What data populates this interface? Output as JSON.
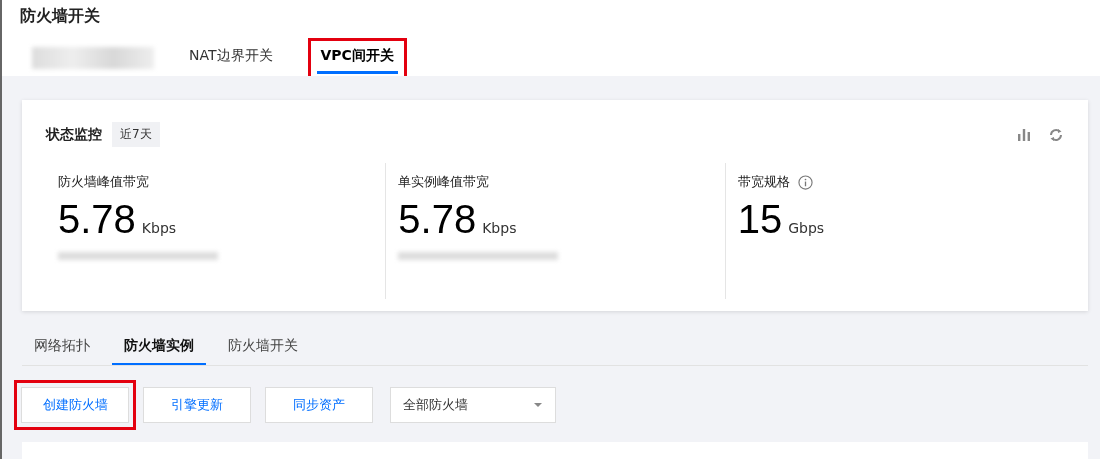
{
  "page": {
    "title": "防火墙开关"
  },
  "top_tabs": [
    {
      "label": "NAT边界开关",
      "selected": false,
      "highlighted": false
    },
    {
      "label": "VPC间开关",
      "selected": true,
      "highlighted": true
    }
  ],
  "monitor": {
    "title": "状态监控",
    "period": "近7天",
    "metrics": [
      {
        "label": "防火墙峰值带宽",
        "value": "5.78",
        "unit": "Kbps",
        "info": false,
        "note_blurred": true
      },
      {
        "label": "单实例峰值带宽",
        "value": "5.78",
        "unit": "Kbps",
        "info": false,
        "note_blurred": true
      },
      {
        "label": "带宽规格",
        "value": "15",
        "unit": "Gbps",
        "info": true,
        "note_blurred": false
      }
    ]
  },
  "sub_tabs": [
    {
      "label": "网络拓扑",
      "selected": false
    },
    {
      "label": "防火墙实例",
      "selected": true
    },
    {
      "label": "防火墙开关",
      "selected": false
    }
  ],
  "actions": [
    {
      "label": "创建防火墙",
      "highlighted": true
    },
    {
      "label": "引擎更新",
      "highlighted": false
    },
    {
      "label": "同步资产",
      "highlighted": false
    }
  ],
  "filter": {
    "value": "全部防火墙"
  }
}
